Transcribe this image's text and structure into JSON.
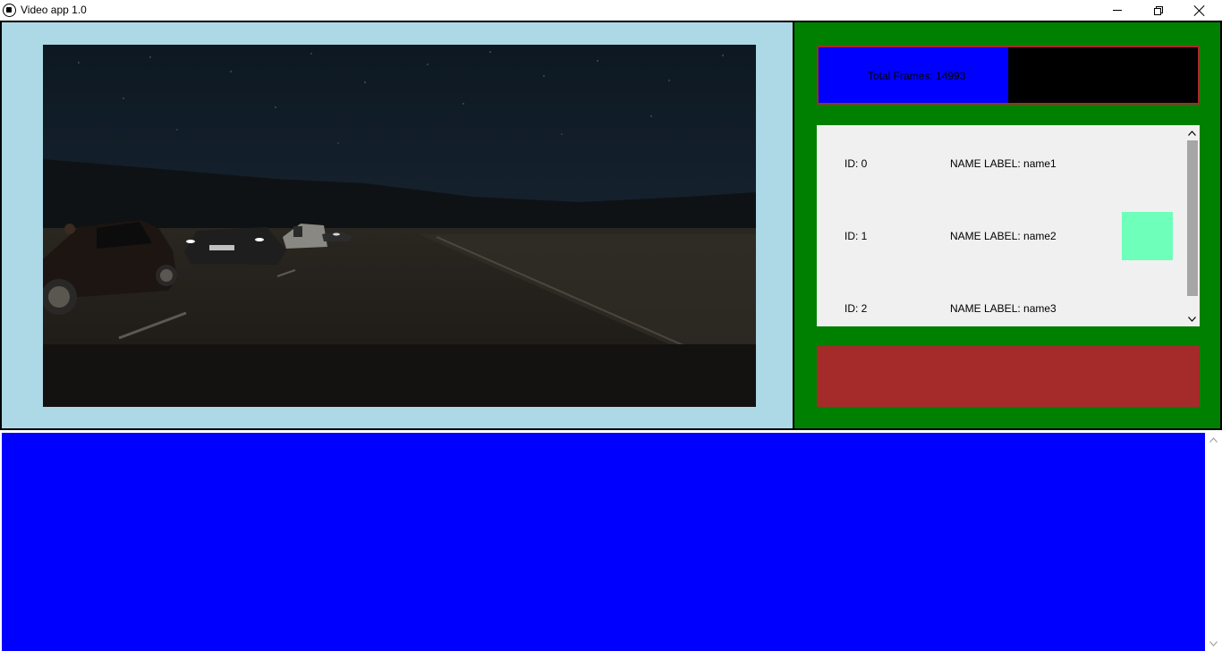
{
  "window": {
    "title": "Video app 1.0",
    "icon": "app-icon",
    "controls": [
      "minimize-icon",
      "restore-icon",
      "close-icon"
    ]
  },
  "video": {
    "description_icon": "video-frame",
    "colors": {
      "panel_bg": "#add8e6"
    }
  },
  "progress": {
    "label": "Total Frames: 14993",
    "fill_fraction": 0.5,
    "colors": {
      "fill": "#0000ff",
      "track": "#000000",
      "border": "#a52a2a"
    }
  },
  "list": {
    "items": [
      {
        "id": "ID: 0",
        "name": "NAME LABEL: name1"
      },
      {
        "id": "ID: 1",
        "name": "NAME LABEL: name2",
        "swatch": "#6effbb"
      },
      {
        "id": "ID: 2",
        "name": "NAME LABEL: name3"
      }
    ],
    "scroll_up": "▲",
    "scroll_down": "▼"
  },
  "colors": {
    "side_panel_bg": "#008000",
    "red_box": "#a52a2a",
    "bottom_panel": "#0000ff"
  }
}
